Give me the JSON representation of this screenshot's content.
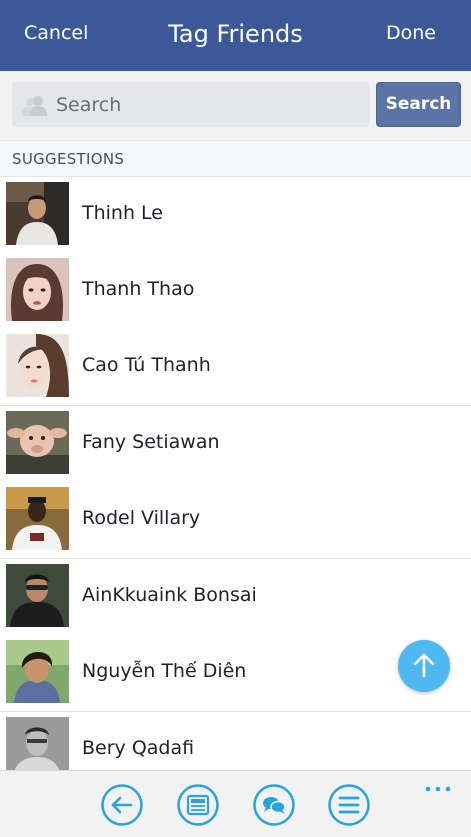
{
  "header": {
    "cancel_label": "Cancel",
    "title": "Tag Friends",
    "done_label": "Done",
    "color": "#3b5998"
  },
  "search": {
    "placeholder": "Search",
    "button_label": "Search"
  },
  "section": {
    "label": "SUGGESTIONS"
  },
  "friends": [
    {
      "name": "Thinh Le"
    },
    {
      "name": "Thanh Thao"
    },
    {
      "name": "Cao Tú Thanh"
    },
    {
      "name": "Fany Setiawan"
    },
    {
      "name": "Rodel Villary"
    },
    {
      "name": "AinKkuaink Bonsai"
    },
    {
      "name": "Nguyễn Thế Diên"
    },
    {
      "name": "Bery Qadafi"
    }
  ],
  "icons": {
    "search_field": "person-silhouette-icon",
    "fab": "arrow-up-icon",
    "appbar": [
      "back-arrow-icon",
      "news-feed-icon",
      "chat-icon",
      "menu-icon",
      "more-dots-icon"
    ]
  },
  "colors": {
    "accent": "#4fb8f0",
    "appbar_icon": "#29a3dc"
  }
}
